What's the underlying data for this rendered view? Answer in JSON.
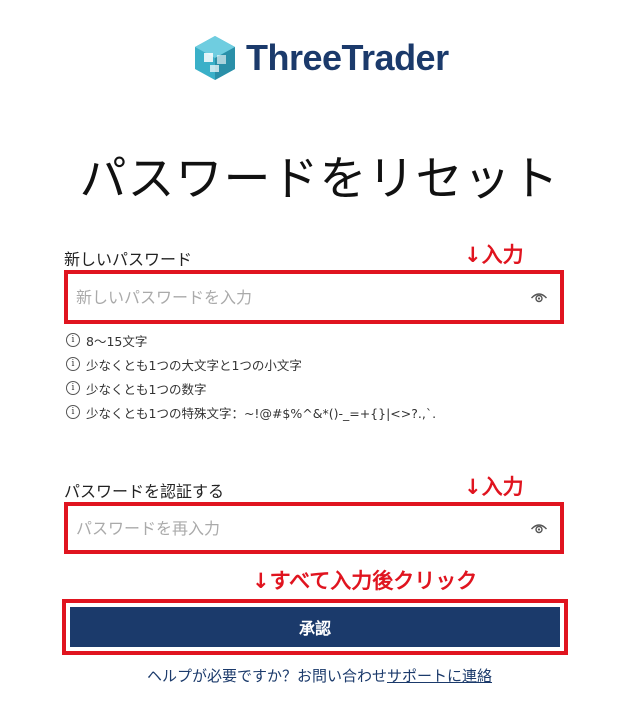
{
  "brand": {
    "name": "ThreeTrader",
    "logo_icon": "cube-logo-icon",
    "accent_color": "#1b3a6b",
    "logo_color": "#3ab0c8"
  },
  "page": {
    "title": "パスワードをリセット"
  },
  "new_password": {
    "label": "新しいパスワード",
    "placeholder": "新しいパスワードを入力",
    "value": "",
    "annotation": "↓入力",
    "toggle_icon": "eye-icon"
  },
  "requirements": [
    {
      "icon": "info-icon",
      "text": "8～15文字"
    },
    {
      "icon": "info-icon",
      "text": "少なくとも1つの大文字と1つの小文字"
    },
    {
      "icon": "info-icon",
      "text": "少なくとも1つの数字"
    },
    {
      "icon": "info-icon",
      "text": "少なくとも1つの特殊文字：~!@#$%^&*()-_=+{}|<>?.,`."
    }
  ],
  "confirm_password": {
    "label": "パスワードを認証する",
    "placeholder": "パスワードを再入力",
    "value": "",
    "annotation": "↓入力",
    "toggle_icon": "eye-icon"
  },
  "submit": {
    "annotation": "↓すべて入力後クリック",
    "label": "承認"
  },
  "help": {
    "text": "ヘルプが必要ですか？お問い合わせ",
    "link": "サポートに連絡"
  },
  "annotation_color": "#e0141f"
}
